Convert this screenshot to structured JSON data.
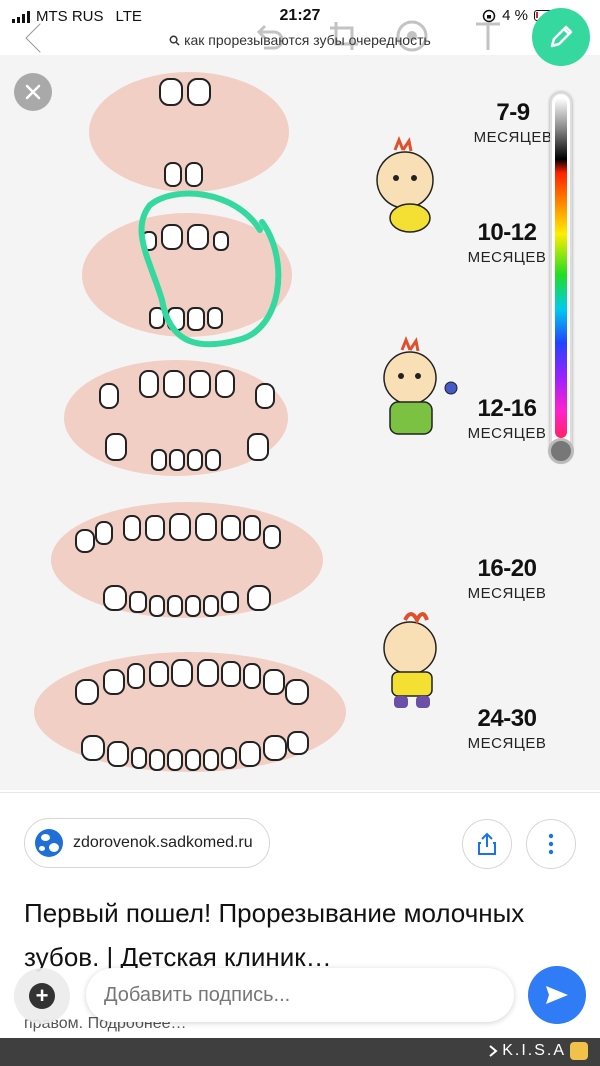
{
  "status_bar": {
    "carrier": "MTS RUS",
    "network": "LTE",
    "time": "21:27",
    "battery": "4 %"
  },
  "toolbar": {
    "search_query": "как прорезываются зубы очередность",
    "icons": [
      "back-icon",
      "undo-icon",
      "crop-icon",
      "draw-icon",
      "text-icon",
      "pencil-icon"
    ]
  },
  "image": {
    "ages": [
      {
        "range": "7-9",
        "unit": "МЕСЯЦЕВ"
      },
      {
        "range": "10-12",
        "unit": "МЕСЯЦЕВ"
      },
      {
        "range": "12-16",
        "unit": "МЕСЯЦЕВ"
      },
      {
        "range": "16-20",
        "unit": "МЕСЯЦЕВ"
      },
      {
        "range": "24-30",
        "unit": "МЕСЯЦЕВ"
      }
    ],
    "annotation_color": "#35d9a0"
  },
  "source": {
    "domain": "zdorovenok.sadkomed.ru",
    "title": "Первый пошел! Прорезывание молочных зубов. | Детская клиник…",
    "subtitle": "правом. Подробнее…"
  },
  "composer": {
    "placeholder": "Добавить подпись..."
  },
  "watermark": "K.I.S.A",
  "colors": {
    "accent": "#35d9a0",
    "send": "#2f7cf6",
    "gum": "#f2cfc4"
  }
}
